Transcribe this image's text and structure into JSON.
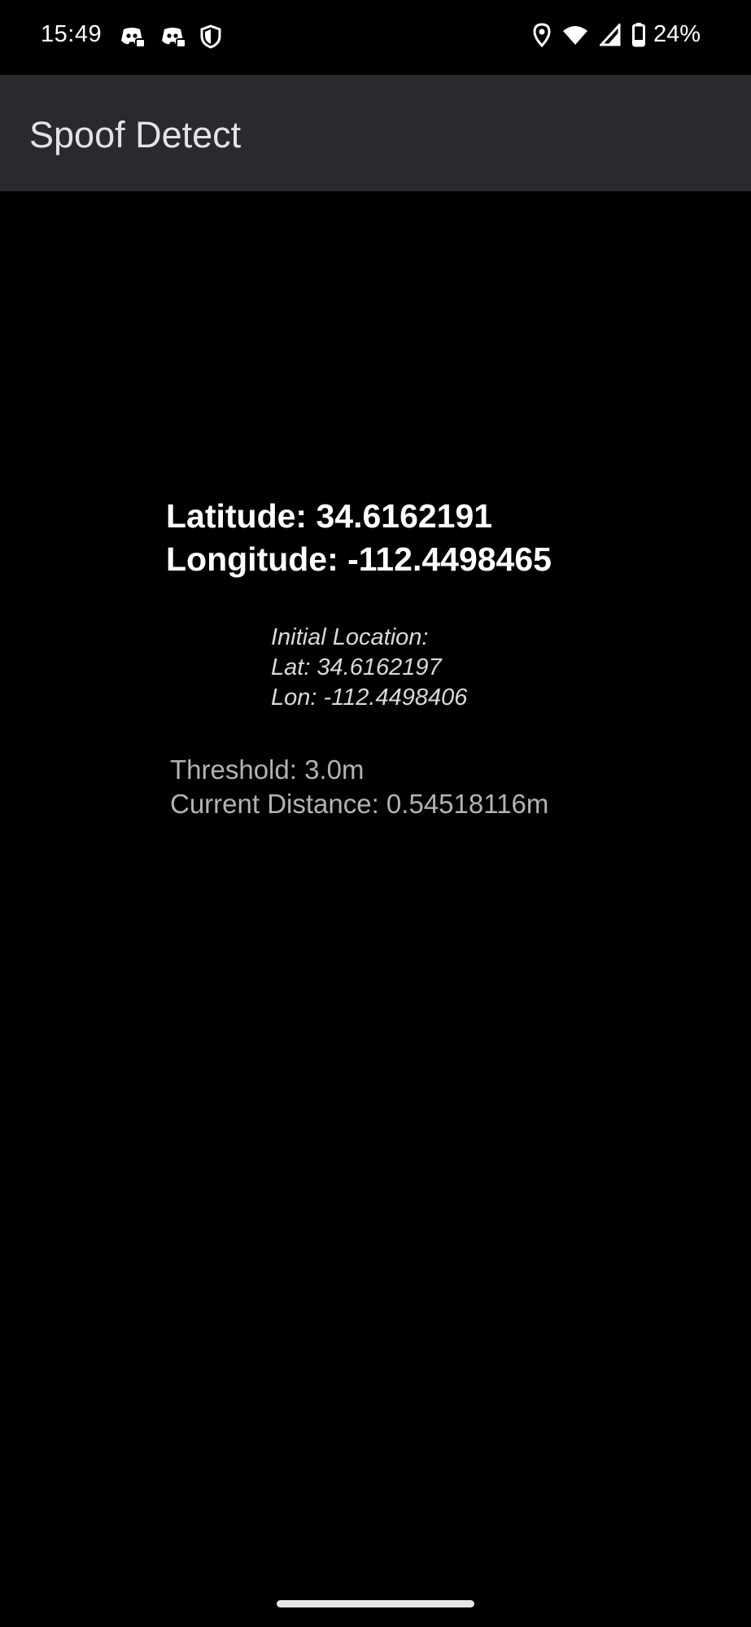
{
  "status_bar": {
    "time": "15:49",
    "battery_percent": "24%",
    "left_icons": [
      "discord-icon",
      "discord-icon",
      "shield-icon"
    ],
    "right_icons": [
      "location-icon",
      "wifi-icon",
      "signal-icon",
      "battery-icon"
    ]
  },
  "app_bar": {
    "title": "Spoof Detect",
    "background": "#2a292f"
  },
  "current_location": {
    "latitude_label": "Latitude: 34.6162191",
    "longitude_label": "Longitude: -112.4498465"
  },
  "initial_location": {
    "heading": "Initial Location:",
    "lat_label": "Lat: 34.6162197",
    "lon_label": "Lon: -112.4498406"
  },
  "distance": {
    "threshold_label": "Threshold: 3.0m",
    "current_label": "Current Distance: 0.54518116m"
  },
  "colors": {
    "background": "#000000",
    "app_bar": "#2a292f",
    "primary_text": "#ffffff",
    "secondary_text": "#b3b3b3"
  }
}
